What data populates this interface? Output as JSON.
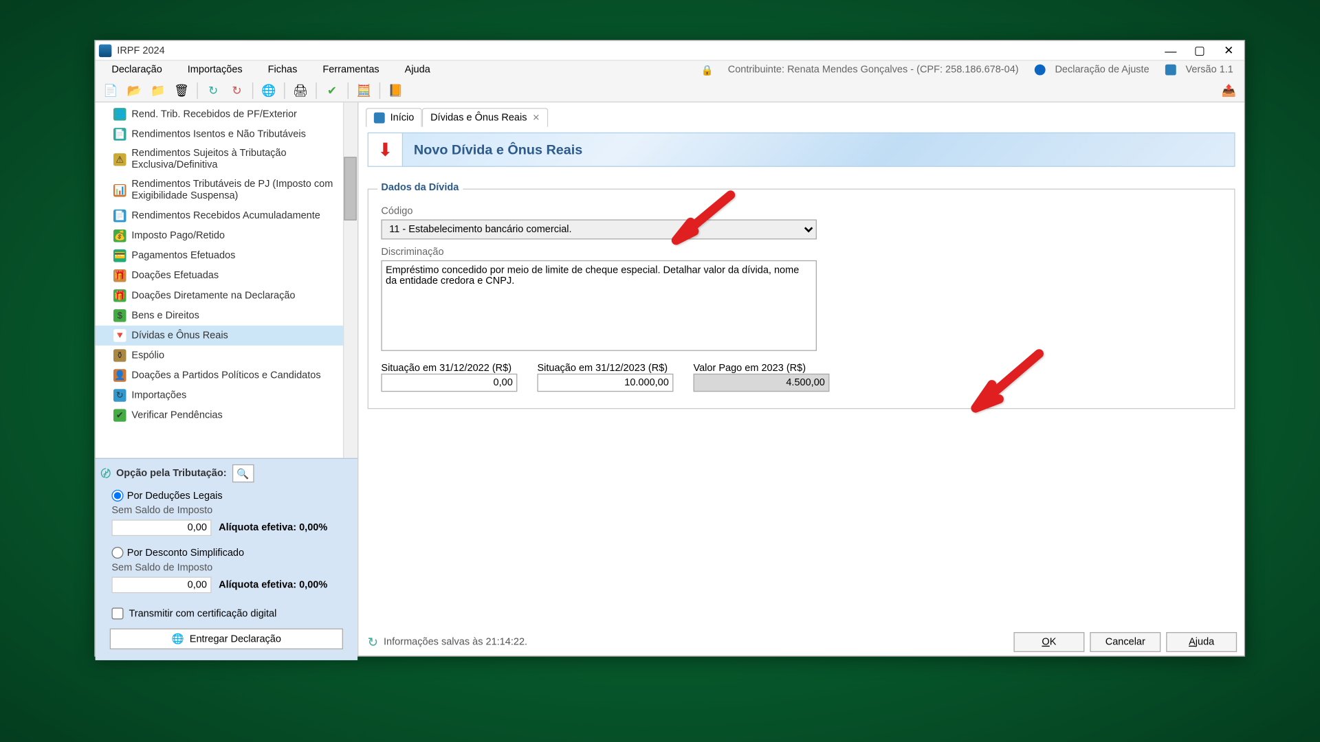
{
  "window": {
    "title": "IRPF 2024"
  },
  "menubar": {
    "items": [
      "Declaração",
      "Importações",
      "Fichas",
      "Ferramentas",
      "Ajuda"
    ],
    "contribuinte_label": "Contribuinte: Renata Mendes Gonçalves - (CPF: 258.186.678-04)",
    "declaracao_label": "Declaração de Ajuste",
    "versao_label": "Versão 1.1"
  },
  "sidebar": {
    "items": [
      {
        "label": "Rend. Trib. Recebidos de PF/Exterior",
        "icon_bg": "#3a9",
        "icon_char": "🌐"
      },
      {
        "label": "Rendimentos Isentos e Não Tributáveis",
        "icon_bg": "#3a9",
        "icon_char": "📄"
      },
      {
        "label": "Rendimentos Sujeitos à Tributação Exclusiva/Definitiva",
        "icon_bg": "#ca3",
        "icon_char": "⚠",
        "multiline": true
      },
      {
        "label": "Rendimentos Tributáveis de PJ (Imposto com Exigibilidade Suspensa)",
        "icon_bg": "#c73",
        "icon_char": "📊",
        "multiline": true
      },
      {
        "label": "Rendimentos Recebidos Acumuladamente",
        "icon_bg": "#39c",
        "icon_char": "📄"
      },
      {
        "label": "Imposto Pago/Retido",
        "icon_bg": "#4a4",
        "icon_char": "💰"
      },
      {
        "label": "Pagamentos Efetuados",
        "icon_bg": "#2a7",
        "icon_char": "💳"
      },
      {
        "label": "Doações Efetuadas",
        "icon_bg": "#c84",
        "icon_char": "🎁"
      },
      {
        "label": "Doações Diretamente na Declaração",
        "icon_bg": "#4a4",
        "icon_char": "🎁"
      },
      {
        "label": "Bens e Direitos",
        "icon_bg": "#4a4",
        "icon_char": "$"
      },
      {
        "label": "Dívidas e Ônus Reais",
        "icon_bg": "#fff",
        "icon_char": "🔻",
        "active": true
      },
      {
        "label": "Espólio",
        "icon_bg": "#a84",
        "icon_char": "⚱"
      },
      {
        "label": "Doações a Partidos Políticos e Candidatos",
        "icon_bg": "#c73",
        "icon_char": "👤"
      },
      {
        "label": "Importações",
        "icon_bg": "#39c",
        "icon_char": "↻"
      },
      {
        "label": "Verificar Pendências",
        "icon_bg": "#4a4",
        "icon_char": "✔"
      }
    ]
  },
  "taxopt": {
    "header": "Opção pela Tributação:",
    "opt1": "Por Deduções Legais",
    "opt1_sub": "Sem Saldo de Imposto",
    "opt1_val": "0,00",
    "opt1_rate": "Alíquota efetiva: 0,00%",
    "opt2": "Por Desconto Simplificado",
    "opt2_sub": "Sem Saldo de Imposto",
    "opt2_val": "0,00",
    "opt2_rate": "Alíquota efetiva: 0,00%",
    "cert_label": "Transmitir com certificação digital",
    "deliver_label": "Entregar Declaração"
  },
  "tabs": {
    "tab1": "Início",
    "tab2": "Dívidas e Ônus Reais"
  },
  "form": {
    "header_title": "Novo Dívida e Ônus Reais",
    "legend": "Dados da Dívida",
    "codigo_label": "Código",
    "codigo_value": "11 - Estabelecimento bancário comercial.",
    "discrim_label": "Discriminação",
    "discrim_value": "Empréstimo concedido por meio de limite de cheque especial. Detalhar valor da dívida, nome da entidade credora e CNPJ.",
    "sit2022_label": "Situação em 31/12/2022 (R$)",
    "sit2022_value": "0,00",
    "sit2023_label": "Situação em 31/12/2023 (R$)",
    "sit2023_value": "10.000,00",
    "pago2023_label": "Valor Pago em 2023 (R$)",
    "pago2023_value": "4.500,00"
  },
  "footer": {
    "info": "Informações salvas às 21:14:22.",
    "ok": "OK",
    "cancel": "Cancelar",
    "help": "Ajuda"
  }
}
